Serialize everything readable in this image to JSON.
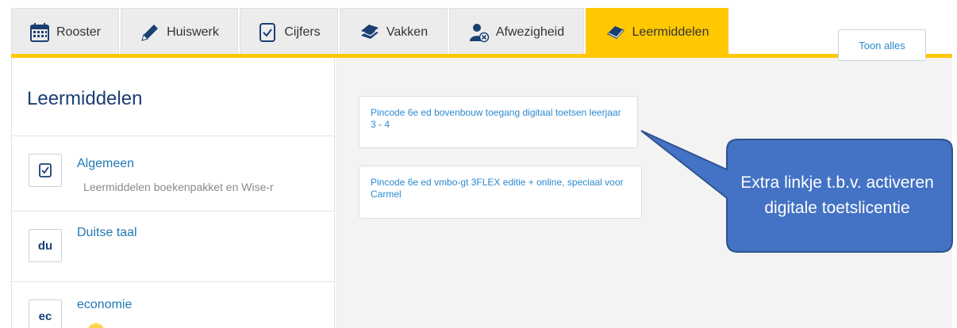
{
  "tabs": [
    {
      "label": "Rooster",
      "icon": "calendar-icon",
      "active": false
    },
    {
      "label": "Huiswerk",
      "icon": "pencil-icon",
      "active": false
    },
    {
      "label": "Cijfers",
      "icon": "grade-document-icon",
      "active": false
    },
    {
      "label": "Vakken",
      "icon": "books-icon",
      "active": false
    },
    {
      "label": "Afwezigheid",
      "icon": "absence-user-icon",
      "active": false
    },
    {
      "label": "Leermiddelen",
      "icon": "book-icon",
      "active": true
    }
  ],
  "colors": {
    "accent": "#ffc800",
    "title": "#1b3f73",
    "link": "#2b8ad0",
    "callout": "#4472c4"
  },
  "sidebar": {
    "title": "Leermiddelen",
    "items": [
      {
        "badge": "",
        "badge_icon": "document-check-icon",
        "name": "Algemeen",
        "subtitle": "Leermiddelen boekenpakket en Wise-r"
      },
      {
        "badge": "du",
        "name": "Duitse taal"
      },
      {
        "badge": "ec",
        "name": "economie"
      }
    ]
  },
  "main": {
    "links": [
      {
        "text": "Pincode 6e ed bovenbouw toegang digitaal toetsen leerjaar 3 - 4"
      },
      {
        "text": "Pincode 6e ed vmbo-gt 3FLEX editie + online, speciaal voor Carmel"
      }
    ],
    "show_all_label": "Toon alles"
  },
  "callout": {
    "text": "Extra linkje t.b.v. activeren digitale toetslicentie"
  }
}
